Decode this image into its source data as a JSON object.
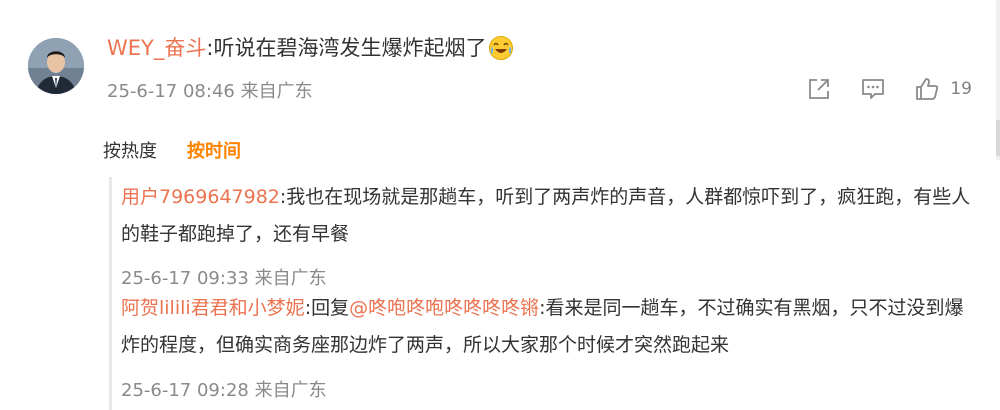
{
  "comment": {
    "author": "WEY_奋斗",
    "separator": ":",
    "text": "听说在碧海湾发生爆炸起烟了",
    "emoji": "laugh-cry-emoji",
    "timestamp": "25-6-17 08:46",
    "source": "来自广东",
    "like_count": "19"
  },
  "sort": {
    "hot_label": "按热度",
    "time_label": "按时间"
  },
  "replies": [
    {
      "author": "用户7969647982",
      "separator": ":",
      "text": "我也在现场就是那趟车，听到了两声炸的声音，人群都惊吓到了，疯狂跑，有些人的鞋子都跑掉了，还有早餐",
      "timestamp": "25-6-17 09:33",
      "source": "来自广东"
    },
    {
      "author": "阿贺lilili君君和小梦妮",
      "separator": ":",
      "reply_prefix": "回复",
      "mention": "@咚咆咚咆咚咚咚咚锵",
      "mention_sep": ":",
      "text": "看来是同一趟车，不过确实有黑烟，只不过没到爆炸的程度，但确实商务座那边炸了两声，所以大家那个时候才突然跑起来",
      "timestamp": "25-6-17 09:28",
      "source": "来自广东"
    }
  ],
  "colors": {
    "name": "#eb7350",
    "accent": "#ff8200",
    "meta": "#8a8a8a",
    "text": "#333333"
  }
}
